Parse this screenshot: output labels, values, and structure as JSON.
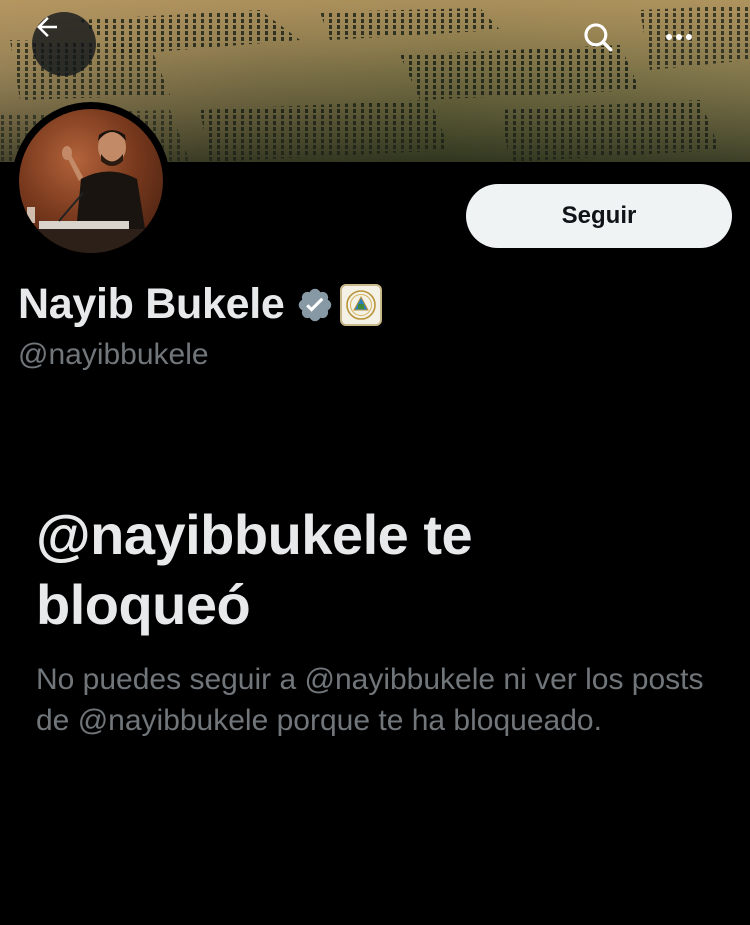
{
  "profile": {
    "display_name": "Nayib Bukele",
    "handle": "@nayibbukele",
    "verified": true,
    "verified_color": "#8899a6"
  },
  "header": {
    "back_icon": "arrow-left-icon",
    "search_icon": "search-icon",
    "more_icon": "more-horizontal-icon"
  },
  "actions": {
    "follow_label": "Seguir"
  },
  "blocked": {
    "title": "@nayibbukele te bloqueó",
    "description": "No puedes seguir a @nayibbukele ni ver los posts de @nayibbukele porque te ha bloqueado."
  },
  "colors": {
    "background": "#000000",
    "text_primary": "#e7e9ea",
    "text_secondary": "#71767b",
    "button_bg": "#eff3f4"
  }
}
